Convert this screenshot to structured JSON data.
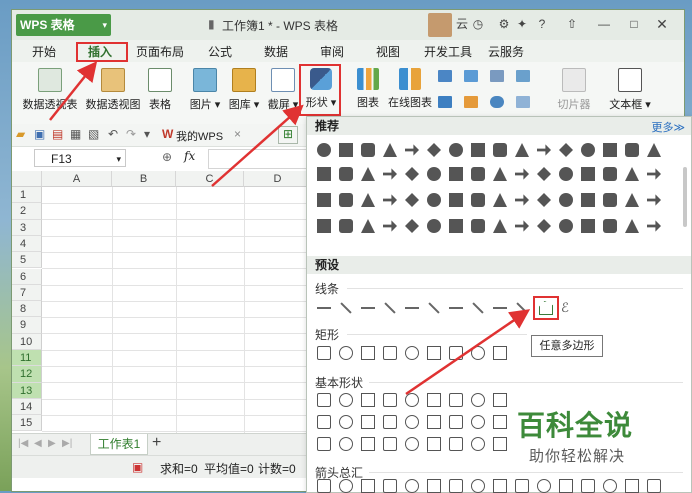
{
  "app": {
    "name": "WPS 表格",
    "title": "工作簿1 * - WPS 表格",
    "cloud_label": "云",
    "help": "?"
  },
  "menu": [
    "开始",
    "插入",
    "页面布局",
    "公式",
    "数据",
    "审阅",
    "视图",
    "开发工具",
    "云服务"
  ],
  "ribbon": {
    "pivot_table": "数据透视表",
    "pivot_chart": "数据透视图",
    "table": "表格",
    "picture": "图片",
    "gallery": "图库",
    "screenshot": "截屏",
    "shapes": "形状",
    "chart": "图表",
    "online_chart": "在线图表",
    "slicer": "切片器",
    "textbox": "文本框"
  },
  "quickbar": {
    "my_wps": "我的WPS"
  },
  "formula": {
    "cell_ref": "F13",
    "fx": "fx"
  },
  "columns": [
    "A",
    "B",
    "C",
    "D"
  ],
  "rows": [
    "1",
    "2",
    "3",
    "4",
    "5",
    "6",
    "7",
    "8",
    "9",
    "10",
    "11",
    "12",
    "13",
    "14",
    "15"
  ],
  "selected_rows": [
    "11",
    "12",
    "13"
  ],
  "sheet": {
    "tab": "工作表1",
    "add": "+"
  },
  "status": {
    "sum": "求和=0",
    "avg": "平均值=0",
    "count": "计数=0"
  },
  "panel": {
    "recommended": "推荐",
    "more": "更多≫",
    "preset": "预设",
    "lines": "线条",
    "rectangles": "矩形",
    "basic_shapes": "基本形状",
    "arrows": "箭头总汇",
    "tooltip": "任意多边形"
  },
  "watermark": {
    "line1": "百科全说",
    "line2": "助你轻松解决"
  },
  "colors": {
    "accent": "#4a9a47",
    "annotation": "#e03232"
  }
}
